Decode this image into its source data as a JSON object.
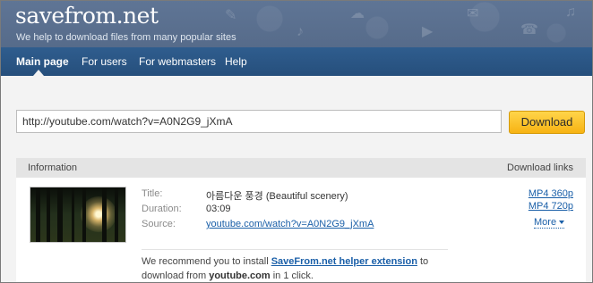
{
  "header": {
    "logo": "savefrom.net",
    "tagline": "We help to download files from many popular sites"
  },
  "nav": {
    "items": [
      {
        "label": "Main page",
        "active": true
      },
      {
        "label": "For users",
        "active": false
      },
      {
        "label": "For webmasters",
        "active": false
      },
      {
        "label": "Help",
        "active": false
      }
    ]
  },
  "search": {
    "value": "http://youtube.com/watch?v=A0N2G9_jXmA",
    "button_label": "Download"
  },
  "result": {
    "header_left": "Information",
    "header_right": "Download links",
    "title_label": "Title:",
    "title_value": "아름다운 풍경 (Beautiful scenery)",
    "duration_label": "Duration:",
    "duration_value": "03:09",
    "source_label": "Source:",
    "source_value": "youtube.com/watch?v=A0N2G9_jXmA",
    "links": [
      "MP4 360p",
      "MP4 720p"
    ],
    "more_label": "More",
    "recommend_prefix": "We recommend you to install",
    "recommend_link": "SaveFrom.net helper extension",
    "recommend_middle": "to download from",
    "recommend_site": "youtube.com",
    "recommend_suffix": "in 1 click."
  },
  "colors": {
    "nav_bg": "#2f5d8e",
    "header_bg": "#5a6f8e",
    "button_bg": "#f7b313",
    "link": "#1a5fa8"
  }
}
